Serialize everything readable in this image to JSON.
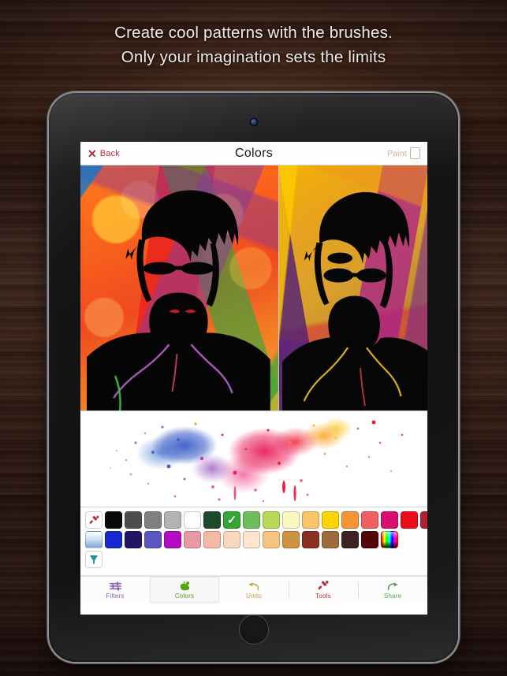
{
  "promo": {
    "line1": "Create cool patterns with the brushes.",
    "line2": "Only your imagination sets the limits"
  },
  "device": {
    "type": "tablet",
    "camera_icon": "front-camera-icon",
    "home_button_icon": "home-button-icon"
  },
  "app": {
    "navbar": {
      "back_icon": "close-x-icon",
      "back_label": "Back",
      "title": "Colors",
      "paint_label": "Paint",
      "paint_icon": "paint-sheet-icon"
    },
    "canvas": {
      "left_panel_name": "artwork-preview-original",
      "right_panel_name": "artwork-preview-filtered",
      "splatter_name": "paint-splatter-canvas"
    },
    "palette": {
      "row1": [
        {
          "name": "eyedropper-tool",
          "type": "tool",
          "icon": "brush-pick-icon",
          "color": "#b3303c"
        },
        {
          "name": "swatch-black",
          "type": "color",
          "color": "#0a0a0a"
        },
        {
          "name": "swatch-dark-gray",
          "type": "color",
          "color": "#4d4d4d"
        },
        {
          "name": "swatch-gray",
          "type": "color",
          "color": "#808080"
        },
        {
          "name": "swatch-light-gray",
          "type": "color",
          "color": "#b3b3b3"
        },
        {
          "name": "swatch-white",
          "type": "color",
          "color": "#ffffff"
        },
        {
          "name": "swatch-dark-green",
          "type": "color",
          "color": "#1e4a2c"
        },
        {
          "name": "swatch-green",
          "type": "color",
          "color": "#33a532",
          "selected": true
        },
        {
          "name": "swatch-medium-green",
          "type": "color",
          "color": "#6cbf59"
        },
        {
          "name": "swatch-yellow-green",
          "type": "color",
          "color": "#b6d957"
        },
        {
          "name": "swatch-pale-yellow",
          "type": "color",
          "color": "#fbf7c0"
        },
        {
          "name": "swatch-light-orange",
          "type": "color",
          "color": "#fcc468"
        },
        {
          "name": "swatch-yellow",
          "type": "color",
          "color": "#fcd400"
        },
        {
          "name": "swatch-orange",
          "type": "color",
          "color": "#f79433"
        },
        {
          "name": "swatch-coral",
          "type": "color",
          "color": "#ef5f62"
        },
        {
          "name": "swatch-magenta",
          "type": "color",
          "color": "#d90d72"
        },
        {
          "name": "swatch-red",
          "type": "color",
          "color": "#ed0c18"
        },
        {
          "name": "swatch-crimson",
          "type": "color",
          "color": "#b32033"
        },
        {
          "name": "swatch-blue-violet",
          "type": "color",
          "color": "#4b5ce8"
        },
        {
          "name": "swatch-sky-blue",
          "type": "color",
          "color": "#3a9ae8"
        }
      ],
      "row2": [
        {
          "name": "gradient-tool",
          "type": "gradient",
          "icon": "gradient-swatch-icon"
        },
        {
          "name": "swatch-blue",
          "type": "color",
          "color": "#1629cc"
        },
        {
          "name": "swatch-indigo",
          "type": "color",
          "color": "#241562"
        },
        {
          "name": "swatch-slate-purple",
          "type": "color",
          "color": "#5b55bf"
        },
        {
          "name": "swatch-purple",
          "type": "color",
          "color": "#b40cc4"
        },
        {
          "name": "swatch-pink",
          "type": "color",
          "color": "#e89aa4"
        },
        {
          "name": "swatch-salmon",
          "type": "color",
          "color": "#f5b9a6"
        },
        {
          "name": "swatch-peach",
          "type": "color",
          "color": "#fad7bf"
        },
        {
          "name": "swatch-cream",
          "type": "color",
          "color": "#fde6cd"
        },
        {
          "name": "swatch-apricot",
          "type": "color",
          "color": "#f8c381"
        },
        {
          "name": "swatch-tan",
          "type": "color",
          "color": "#cf9243"
        },
        {
          "name": "swatch-rust",
          "type": "color",
          "color": "#8a2f21"
        },
        {
          "name": "swatch-brown",
          "type": "color",
          "color": "#9e6b3c"
        },
        {
          "name": "swatch-dark-brown",
          "type": "color",
          "color": "#402225"
        },
        {
          "name": "swatch-maroon",
          "type": "color",
          "color": "#52060a"
        },
        {
          "name": "color-picker-rainbow",
          "type": "rainbow",
          "icon": "rainbow-picker-icon"
        }
      ],
      "row3": [
        {
          "name": "fill-funnel-tool",
          "type": "tool",
          "icon": "funnel-icon",
          "color": "#1f8f96"
        }
      ]
    },
    "tabs": [
      {
        "name": "tab-filters",
        "label": "Filters",
        "icon": "sliders-icon",
        "color": "#8d5fb0",
        "active": false
      },
      {
        "name": "tab-colors",
        "label": "Colors",
        "icon": "paint-blob-icon",
        "color": "#53a318",
        "active": true
      },
      {
        "name": "tab-undo",
        "label": "Undo",
        "icon": "undo-arrow-icon",
        "color": "#c8a646",
        "active": false
      },
      {
        "name": "tab-tools",
        "label": "Tools",
        "icon": "brush-tool-icon",
        "color": "#b33040",
        "active": false
      },
      {
        "name": "tab-share",
        "label": "Share",
        "icon": "share-arrow-icon",
        "color": "#5aa05a",
        "active": false
      }
    ]
  }
}
